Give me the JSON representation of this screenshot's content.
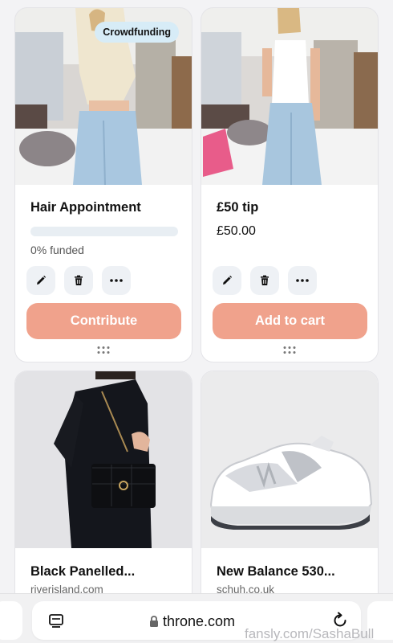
{
  "cards": [
    {
      "badge": "Crowdfunding",
      "title": "Hair Appointment",
      "funded_text": "0% funded",
      "funded_fraction": 0,
      "cta_label": "Contribute"
    },
    {
      "title": "£50 tip",
      "price": "£50.00",
      "cta_label": "Add to cart"
    },
    {
      "title": "Black Panelled...",
      "domain": "riverisland.com"
    },
    {
      "title": "New Balance 530...",
      "domain": "schuh.co.uk"
    }
  ],
  "actions": {
    "edit_icon": "pencil-icon",
    "delete_icon": "trash-icon",
    "more_icon": "more-dots-icon"
  },
  "browser": {
    "url": "throne.com",
    "tabs_icon": "tabs-icon",
    "lock_icon": "lock-icon",
    "reload_icon": "reload-icon"
  },
  "watermark": "fansly.com/SashaBull",
  "colors": {
    "accent": "#f0a28c",
    "badge_bg": "#d7ecf7",
    "button_bg": "#eef1f5"
  }
}
